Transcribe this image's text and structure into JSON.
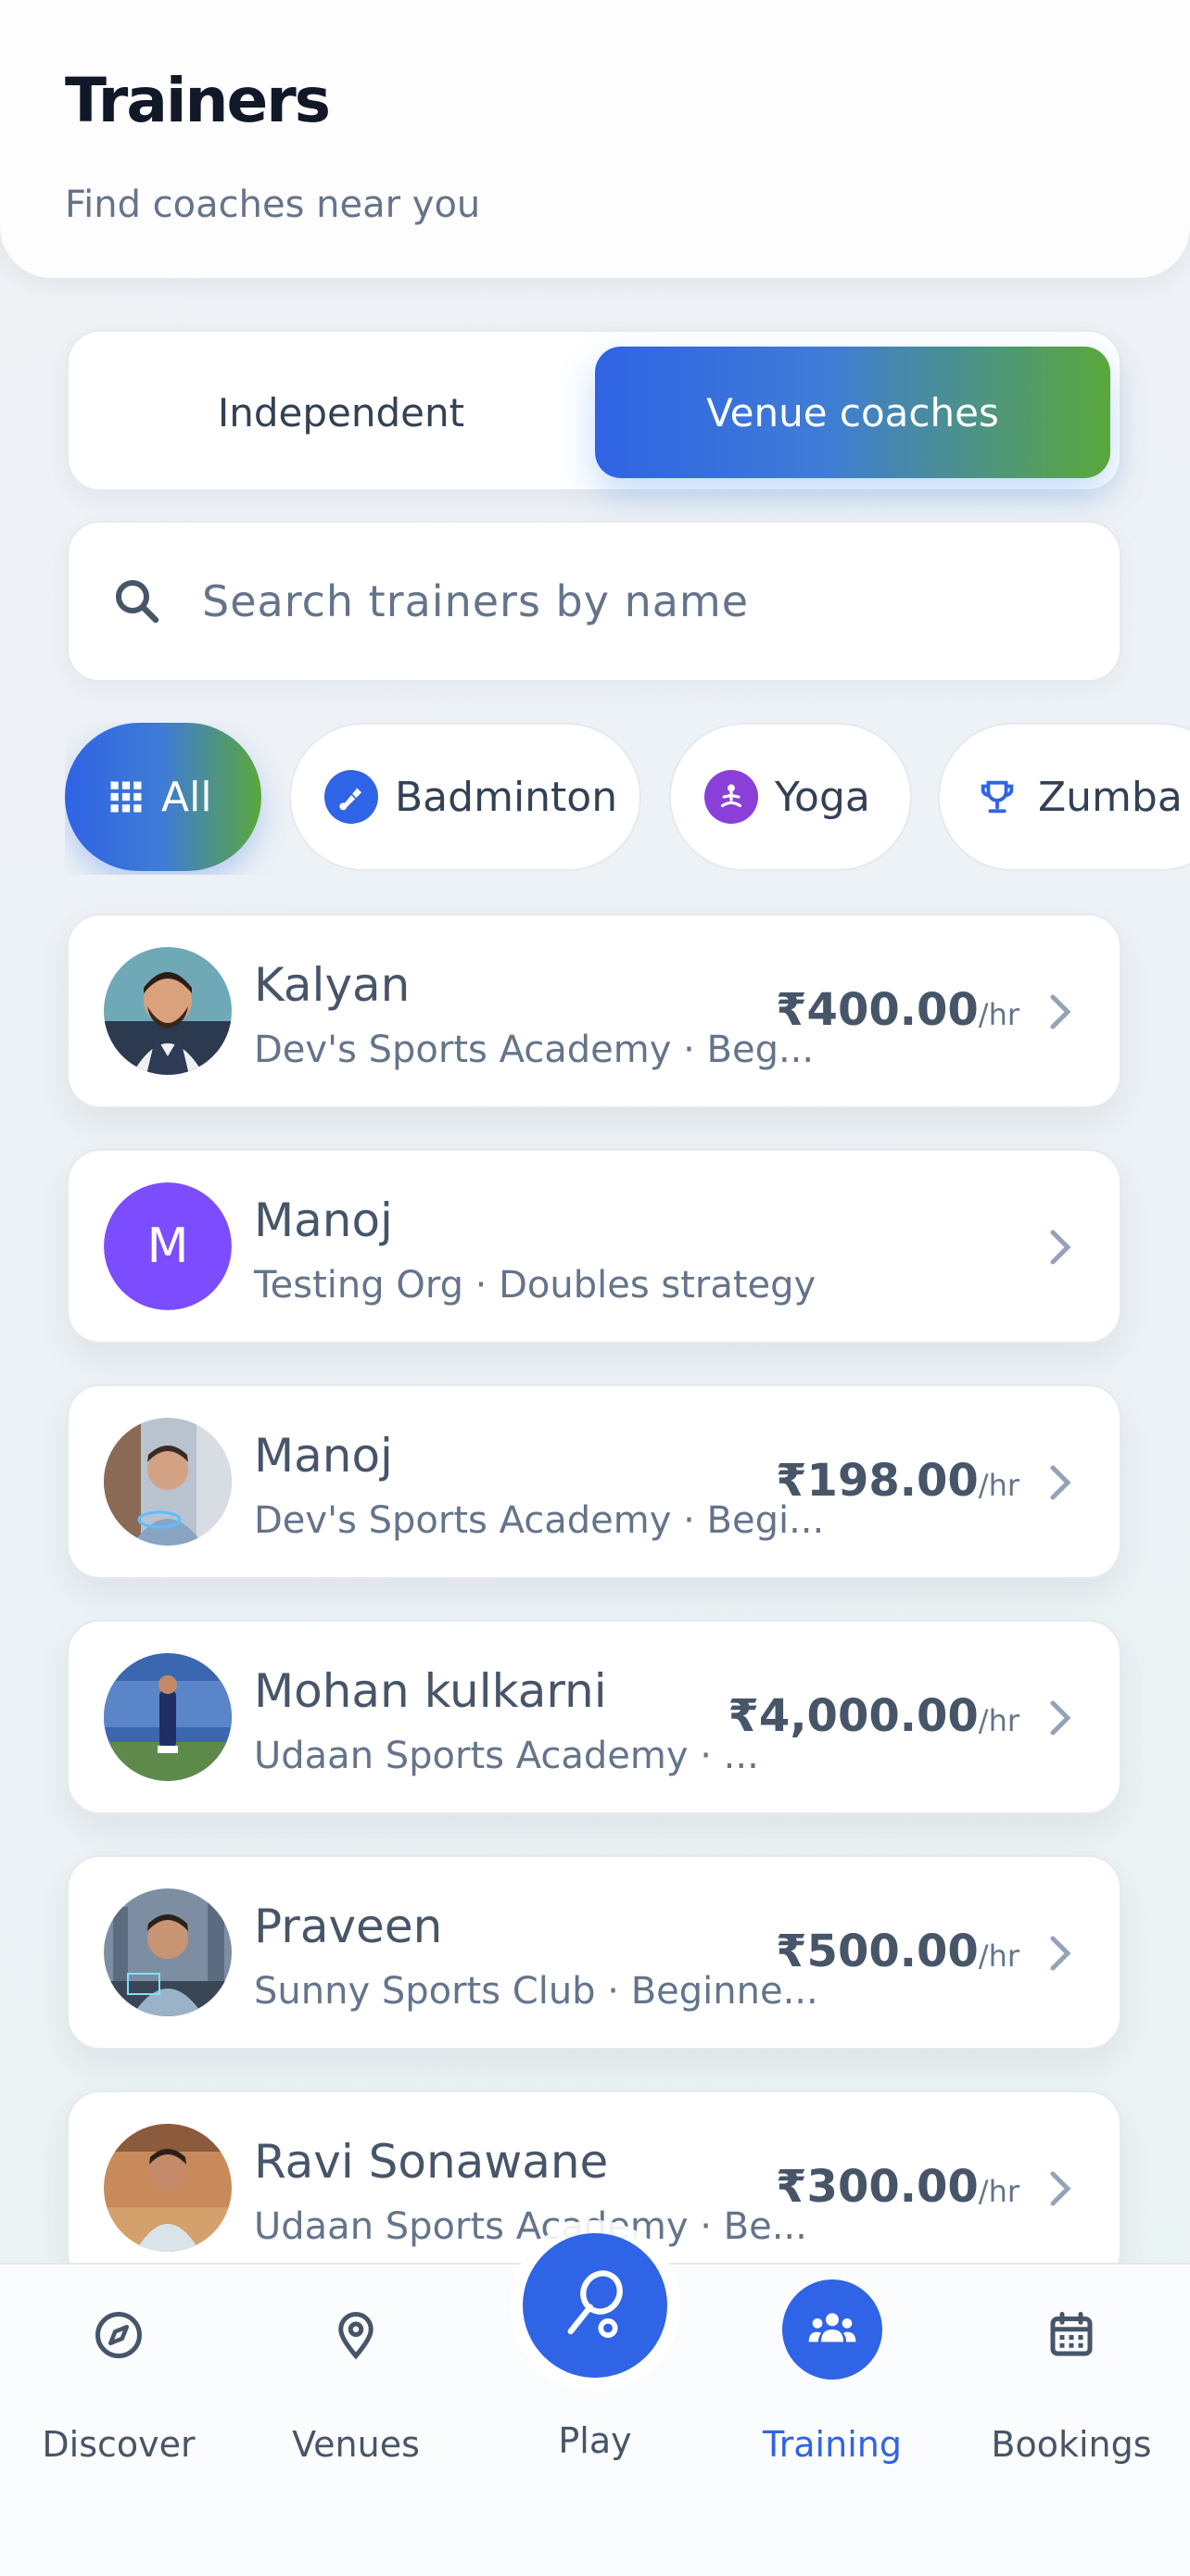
{
  "header": {
    "title": "Trainers",
    "subtitle": "Find coaches near you"
  },
  "toggle": {
    "options": [
      "Independent",
      "Venue coaches"
    ],
    "selected": "Venue coaches"
  },
  "search": {
    "placeholder": "Search trainers by name",
    "icon": "search-icon"
  },
  "filters": [
    {
      "label": "All",
      "icon": "grid-icon",
      "active": true
    },
    {
      "label": "Badminton",
      "icon": "shuttlecock-icon",
      "active": false
    },
    {
      "label": "Yoga",
      "icon": "yoga-icon",
      "active": false
    },
    {
      "label": "Zumba",
      "icon": "trophy-icon",
      "active": false
    }
  ],
  "trainers": [
    {
      "name": "Kalyan",
      "subtitle": "Dev's Sports Academy · Beg...",
      "price": "₹400.00",
      "unit": "/hr"
    },
    {
      "name": "Manoj",
      "subtitle": "Testing Org · Doubles strategy",
      "price": "",
      "unit": "",
      "initial": "M"
    },
    {
      "name": "Manoj",
      "subtitle": "Dev's Sports Academy · Begi...",
      "price": "₹198.00",
      "unit": "/hr"
    },
    {
      "name": "Mohan kulkarni",
      "subtitle": "Udaan Sports Academy · ...",
      "price": "₹4,000.00",
      "unit": "/hr"
    },
    {
      "name": "Praveen",
      "subtitle": "Sunny Sports Club · Beginne...",
      "price": "₹500.00",
      "unit": "/hr"
    },
    {
      "name": "Ravi Sonawane",
      "subtitle": "Udaan Sports Academy · Be...",
      "price": "₹300.00",
      "unit": "/hr"
    }
  ],
  "nav": {
    "items": [
      {
        "label": "Discover",
        "icon": "compass-icon"
      },
      {
        "label": "Venues",
        "icon": "location-pin-icon"
      },
      {
        "label": "Play",
        "icon": "racket-icon"
      },
      {
        "label": "Training",
        "icon": "group-icon",
        "active": true
      },
      {
        "label": "Bookings",
        "icon": "calendar-icon"
      }
    ],
    "active_color": "#2f64e6"
  }
}
